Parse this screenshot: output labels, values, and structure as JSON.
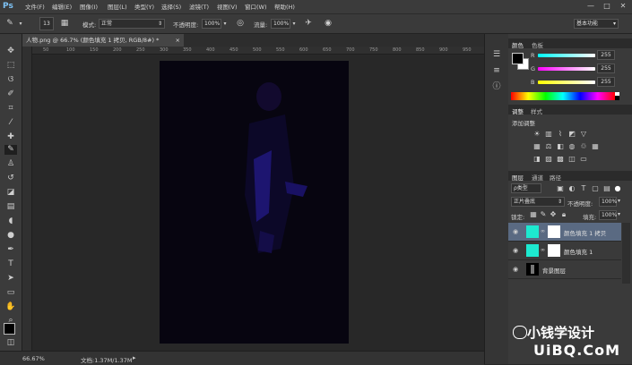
{
  "app": {
    "logo": "Ps"
  },
  "menu": [
    "文件(F)",
    "编辑(E)",
    "图像(I)",
    "图层(L)",
    "类型(Y)",
    "选择(S)",
    "滤镜(T)",
    "视图(V)",
    "窗口(W)",
    "帮助(H)"
  ],
  "window_controls": {
    "minimize": "—",
    "maximize": "□",
    "close": "✕"
  },
  "options": {
    "brush_size": "13",
    "mode_label": "模式:",
    "mode_value": "正常",
    "opacity_label": "不透明度:",
    "opacity_value": "100%",
    "flow_label": "流量:",
    "flow_value": "100%",
    "workspace": "基本功能"
  },
  "document": {
    "tab_title": "人物.png @ 66.7% (颜色填充 1 拷贝, RGB/8#) *",
    "zoom": "66.67%",
    "doc_size": "文档:1.37M/1.37M"
  },
  "ruler_ticks": [
    "50",
    "100",
    "150",
    "200",
    "250",
    "300",
    "350",
    "400",
    "450",
    "500",
    "550",
    "600",
    "650",
    "700",
    "750",
    "800",
    "850",
    "900",
    "950"
  ],
  "tools": [
    "move-tool",
    "marquee-tool",
    "lasso-tool",
    "quick-select-tool",
    "crop-tool",
    "eyedropper-tool",
    "healing-tool",
    "brush-tool",
    "clone-stamp-tool",
    "history-brush-tool",
    "eraser-tool",
    "gradient-tool",
    "blur-tool",
    "dodge-tool",
    "pen-tool",
    "type-tool",
    "path-select-tool",
    "shape-tool",
    "hand-tool",
    "zoom-tool"
  ],
  "color_panel": {
    "tabs": [
      "颜色",
      "色板"
    ],
    "channels": [
      {
        "label": "R",
        "value": "255"
      },
      {
        "label": "G",
        "value": "255"
      },
      {
        "label": "B",
        "value": "255"
      }
    ]
  },
  "adjust_panel": {
    "tabs": [
      "调整",
      "样式"
    ],
    "title": "添加调整"
  },
  "layers_panel": {
    "tabs": [
      "图层",
      "通道",
      "路径"
    ],
    "filter": "ρ类型",
    "blend_mode": "正片叠底",
    "opacity_label": "不透明度:",
    "opacity_value": "100%",
    "lock_label": "锁定:",
    "fill_label": "填充:",
    "fill_value": "100%",
    "layers": [
      {
        "name": "颜色填充 1 拷贝",
        "selected": true,
        "thumb": "#1de9d0"
      },
      {
        "name": "颜色填充 1",
        "selected": false,
        "thumb": "#1de9d0"
      },
      {
        "name": "背景图层",
        "selected": false,
        "thumb": "#000000"
      }
    ]
  },
  "watermark": {
    "line1": "小钱学设计",
    "line2": "UiBQ.CoM"
  },
  "colors": {
    "accent_teal": "#1de9d0",
    "selected_layer": "#5a6a82"
  }
}
